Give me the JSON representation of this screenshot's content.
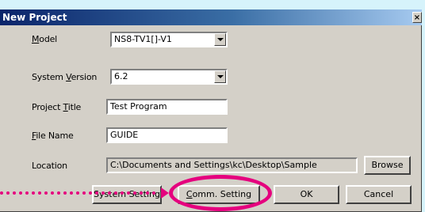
{
  "dialog": {
    "title": "New Project",
    "close_glyph": "×"
  },
  "form": {
    "model": {
      "label_mnemonic": "M",
      "label_rest": "odel",
      "value": "NS8-TV1[]-V1"
    },
    "system_version": {
      "label_prefix": "System ",
      "label_mnemonic": "V",
      "label_rest": "ersion",
      "value": "6.2"
    },
    "project_title": {
      "label_prefix": "Project ",
      "label_mnemonic": "T",
      "label_rest": "itle",
      "value": "Test Program"
    },
    "file_name": {
      "label_mnemonic": "F",
      "label_rest": "ile Name",
      "value": "GUIDE"
    },
    "location": {
      "label": "Location",
      "value": "C:\\Documents and Settings\\kc\\Desktop\\Sample"
    }
  },
  "buttons": {
    "browse": "Browse",
    "system_setting": "System Setting",
    "comm_setting_mnemonic": "C",
    "comm_setting_rest": "omm. Setting",
    "ok": "OK",
    "cancel": "Cancel"
  },
  "colors": {
    "highlight": "#e5007e",
    "background": "#d6f3fb",
    "dialog_face": "#d4d0c8",
    "titlebar_start": "#0a246a"
  },
  "icons": {
    "close": "close-icon",
    "dropdown": "chevron-down-icon"
  }
}
